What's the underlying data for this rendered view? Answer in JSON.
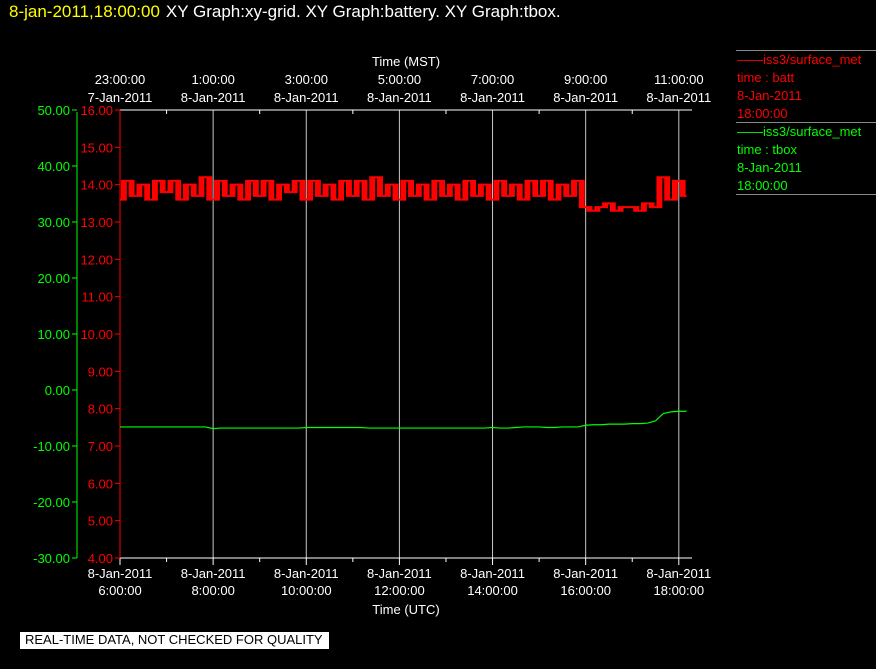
{
  "header": {
    "timestamp": "8-jan-2011,18:00:00",
    "title": "XY Graph:xy-grid.  XY Graph:battery.  XY Graph:tbox."
  },
  "colors": {
    "batt": "#ff0000",
    "tbox": "#00ff00",
    "grid": "#c8c8c8",
    "timestamp": "#ffff00"
  },
  "legend": [
    {
      "line1": "iss3/surface_met",
      "line2": "time : batt",
      "line3": "8-Jan-2011",
      "line4": "18:00:00",
      "color": "#ff0000"
    },
    {
      "line1": "iss3/surface_met",
      "line2": "time : tbox",
      "line3": "8-Jan-2011",
      "line4": "18:00:00",
      "color": "#00ff00"
    }
  ],
  "quality_note": "REAL-TIME DATA, NOT CHECKED FOR QUALITY",
  "chart_data": {
    "type": "line",
    "xlabel": "Time (UTC)",
    "x2label": "Time (MST)",
    "xlim": [
      "06:00",
      "18:17"
    ],
    "x_ticks": [
      {
        "x": "06:00",
        "date": "8-Jan-2011",
        "time": "6:00:00"
      },
      {
        "x": "08:00",
        "date": "8-Jan-2011",
        "time": "8:00:00"
      },
      {
        "x": "10:00",
        "date": "8-Jan-2011",
        "time": "10:00:00"
      },
      {
        "x": "12:00",
        "date": "8-Jan-2011",
        "time": "12:00:00"
      },
      {
        "x": "14:00",
        "date": "8-Jan-2011",
        "time": "14:00:00"
      },
      {
        "x": "16:00",
        "date": "8-Jan-2011",
        "time": "16:00:00"
      },
      {
        "x": "18:00",
        "date": "8-Jan-2011",
        "time": "18:00:00"
      }
    ],
    "x2_ticks": [
      {
        "x": "06:00",
        "time": "23:00:00",
        "date": "7-Jan-2011"
      },
      {
        "x": "08:00",
        "time": "1:00:00",
        "date": "8-Jan-2011"
      },
      {
        "x": "10:00",
        "time": "3:00:00",
        "date": "8-Jan-2011"
      },
      {
        "x": "12:00",
        "time": "5:00:00",
        "date": "8-Jan-2011"
      },
      {
        "x": "14:00",
        "time": "7:00:00",
        "date": "8-Jan-2011"
      },
      {
        "x": "16:00",
        "time": "9:00:00",
        "date": "8-Jan-2011"
      },
      {
        "x": "18:00",
        "time": "11:00:00",
        "date": "8-Jan-2011"
      }
    ],
    "y_batt": {
      "lim": [
        4,
        16
      ],
      "ticks": [
        "4.00",
        "5.00",
        "6.00",
        "7.00",
        "8.00",
        "9.00",
        "10.00",
        "11.00",
        "12.00",
        "13.00",
        "14.00",
        "15.00",
        "16.00"
      ]
    },
    "y_tbox": {
      "lim": [
        -30,
        50
      ],
      "ticks": [
        "-30.00",
        "-20.00",
        "-10.00",
        "0.00",
        "10.00",
        "20.00",
        "30.00",
        "40.00",
        "50.00"
      ]
    },
    "grid": "vertical",
    "x": [
      "06:00",
      "06:10",
      "06:20",
      "06:30",
      "06:40",
      "06:50",
      "07:00",
      "07:10",
      "07:20",
      "07:30",
      "07:40",
      "07:50",
      "08:00",
      "08:10",
      "08:20",
      "08:30",
      "08:40",
      "08:50",
      "09:00",
      "09:10",
      "09:20",
      "09:30",
      "09:40",
      "09:50",
      "10:00",
      "10:10",
      "10:20",
      "10:30",
      "10:40",
      "10:50",
      "11:00",
      "11:10",
      "11:20",
      "11:30",
      "11:40",
      "11:50",
      "12:00",
      "12:10",
      "12:20",
      "12:30",
      "12:40",
      "12:50",
      "13:00",
      "13:10",
      "13:20",
      "13:30",
      "13:40",
      "13:50",
      "14:00",
      "14:10",
      "14:20",
      "14:30",
      "14:40",
      "14:50",
      "15:00",
      "15:10",
      "15:20",
      "15:30",
      "15:40",
      "15:50",
      "16:00",
      "16:10",
      "16:20",
      "16:30",
      "16:40",
      "16:50",
      "17:00",
      "17:10",
      "17:20",
      "17:30",
      "17:40",
      "17:50",
      "18:00",
      "18:10"
    ],
    "series": [
      {
        "key": "batt",
        "axis": "y_batt",
        "values": [
          13.6,
          14.1,
          13.7,
          14.0,
          13.6,
          14.1,
          13.8,
          14.1,
          13.6,
          14.0,
          13.7,
          14.2,
          13.6,
          14.1,
          13.7,
          14.0,
          13.6,
          14.1,
          13.7,
          14.1,
          13.6,
          14.0,
          13.8,
          14.1,
          13.6,
          14.1,
          13.7,
          14.0,
          13.6,
          14.1,
          13.7,
          14.1,
          13.6,
          14.2,
          13.7,
          14.0,
          13.6,
          14.1,
          13.7,
          14.0,
          13.6,
          14.1,
          13.7,
          14.0,
          13.6,
          14.1,
          13.7,
          14.0,
          13.6,
          14.1,
          13.7,
          14.0,
          13.6,
          14.1,
          13.7,
          14.1,
          13.6,
          14.0,
          13.7,
          14.1,
          13.4,
          13.3,
          13.4,
          13.5,
          13.3,
          13.4,
          13.4,
          13.3,
          13.5,
          13.4,
          14.2,
          13.6,
          14.1,
          13.7
        ]
      },
      {
        "key": "tbox",
        "axis": "y_tbox",
        "values": [
          -6.6,
          -6.6,
          -6.6,
          -6.6,
          -6.6,
          -6.6,
          -6.6,
          -6.6,
          -6.6,
          -6.6,
          -6.6,
          -6.6,
          -6.9,
          -6.8,
          -6.8,
          -6.8,
          -6.8,
          -6.8,
          -6.8,
          -6.8,
          -6.8,
          -6.8,
          -6.8,
          -6.8,
          -6.7,
          -6.7,
          -6.7,
          -6.7,
          -6.7,
          -6.7,
          -6.7,
          -6.7,
          -6.8,
          -6.8,
          -6.8,
          -6.8,
          -6.8,
          -6.8,
          -6.8,
          -6.8,
          -6.8,
          -6.8,
          -6.8,
          -6.8,
          -6.8,
          -6.8,
          -6.8,
          -6.8,
          -6.7,
          -6.8,
          -6.8,
          -6.7,
          -6.6,
          -6.6,
          -6.6,
          -6.7,
          -6.7,
          -6.6,
          -6.6,
          -6.6,
          -6.3,
          -6.2,
          -6.2,
          -6.1,
          -6.1,
          -6.1,
          -6.0,
          -6.0,
          -5.9,
          -5.5,
          -4.2,
          -3.9,
          -3.8,
          -3.8
        ]
      }
    ]
  }
}
